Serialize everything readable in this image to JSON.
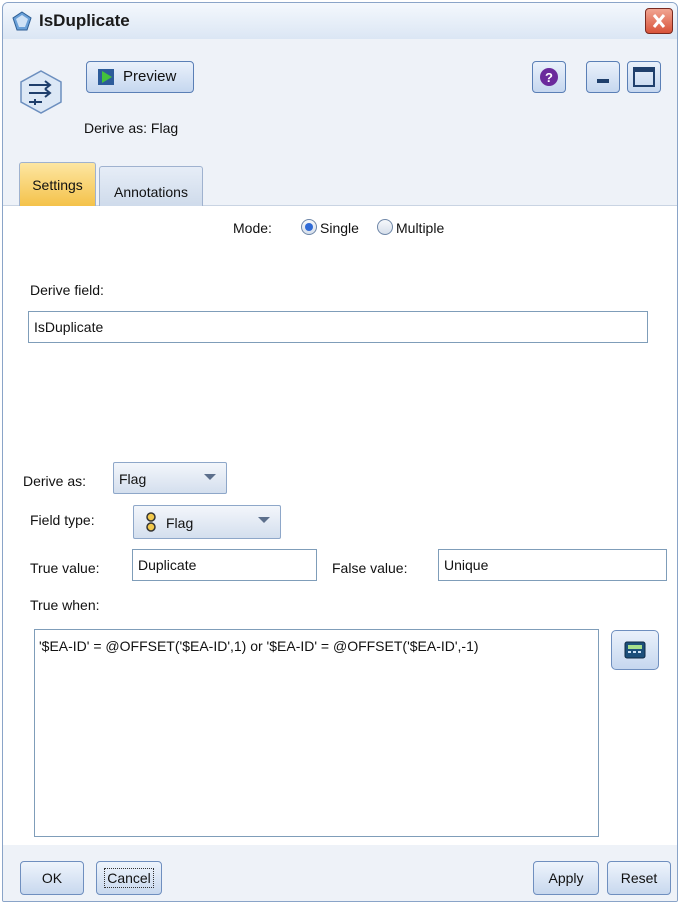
{
  "window": {
    "title": "IsDuplicate"
  },
  "toolbar": {
    "preview_label": "Preview",
    "derive_as_text": "Derive as: Flag"
  },
  "tabs": [
    {
      "label": "Settings",
      "active": true
    },
    {
      "label": "Annotations",
      "active": false
    }
  ],
  "settings": {
    "mode_label": "Mode:",
    "mode_options": [
      "Single",
      "Multiple"
    ],
    "mode_selected": "Single",
    "derive_field_label": "Derive field:",
    "derive_field_value": "IsDuplicate",
    "derive_as_label": "Derive as:",
    "derive_as_value": "Flag",
    "field_type_label": "Field type:",
    "field_type_value": "Flag",
    "true_value_label": "True value:",
    "true_value": "Duplicate",
    "false_value_label": "False value:",
    "false_value": "Unique",
    "true_when_label": "True when:",
    "true_when_expr": "'$EA-ID' = @OFFSET('$EA-ID',1) or '$EA-ID' = @OFFSET('$EA-ID',-1)"
  },
  "footer": {
    "ok": "OK",
    "cancel": "Cancel",
    "apply": "Apply",
    "reset": "Reset"
  },
  "colors": {
    "active_tab": "#f4c24a",
    "close_button": "#d9533a",
    "radio_selected": "#2f6ad6"
  },
  "icons": [
    "derive-node-icon",
    "play-icon",
    "help-icon",
    "minimize-icon",
    "maximize-icon",
    "close-icon",
    "flag-icon",
    "calculator-icon"
  ]
}
